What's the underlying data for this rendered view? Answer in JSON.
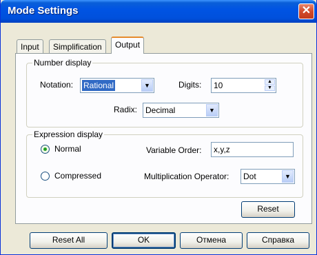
{
  "window": {
    "title": "Mode Settings",
    "close_label": "✕"
  },
  "tabs": [
    {
      "label": "Input"
    },
    {
      "label": "Simplification"
    },
    {
      "label": "Output"
    }
  ],
  "number_display": {
    "legend": "Number display",
    "notation_label": "Notation:",
    "notation_value": "Rational",
    "digits_label": "Digits:",
    "digits_value": "10",
    "radix_label": "Radix:",
    "radix_value": "Decimal"
  },
  "expression_display": {
    "legend": "Expression display",
    "normal_label": "Normal",
    "compressed_label": "Compressed",
    "selected_mode": "Normal",
    "variable_order_label": "Variable Order:",
    "variable_order_value": "x,y,z",
    "mult_operator_label": "Multiplication Operator:",
    "mult_operator_value": "Dot"
  },
  "panel": {
    "reset_label": "Reset"
  },
  "footer": {
    "reset_all_label": "Reset All",
    "ok_label": "OK",
    "cancel_label": "Отмена",
    "help_label": "Справка"
  }
}
